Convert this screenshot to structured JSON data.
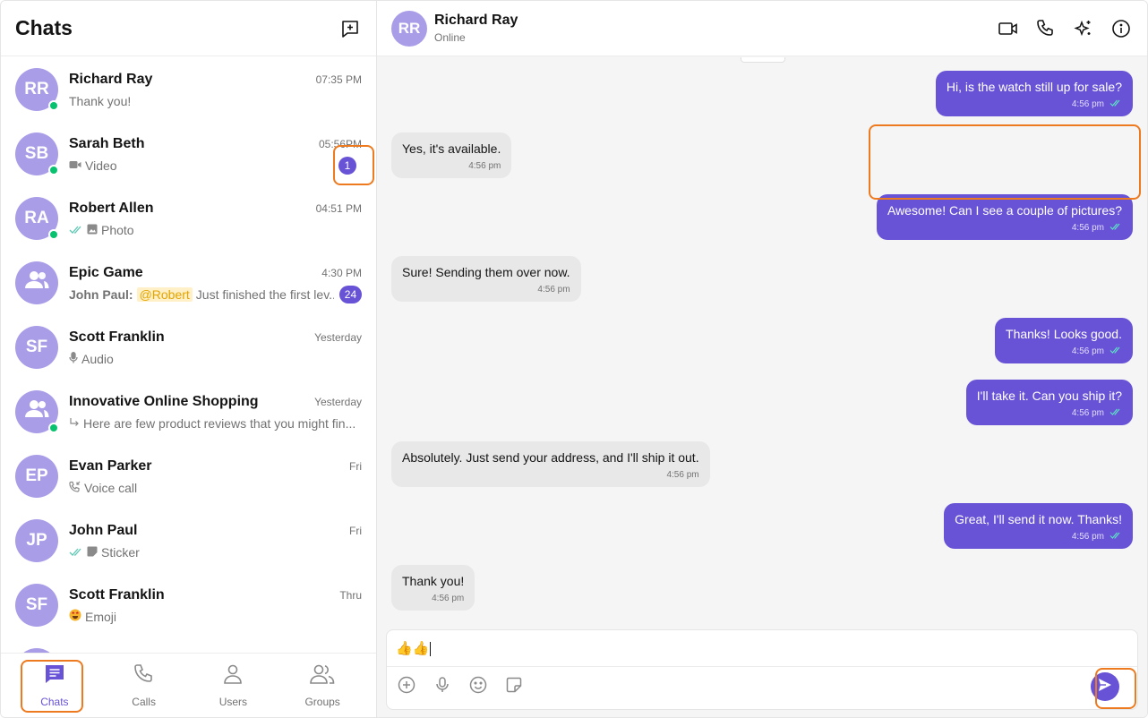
{
  "sidebar": {
    "title": "Chats",
    "new_chat_icon": "new-chat-icon",
    "chats": [
      {
        "initials": "RR",
        "name": "Richard Ray",
        "time": "07:35 PM",
        "preview": "Thank you!",
        "online": true
      },
      {
        "initials": "SB",
        "name": "Sarah Beth",
        "time": "05:56PM",
        "preview": "Video",
        "preview_icon": "video-icon",
        "badge": "1",
        "online": true
      },
      {
        "initials": "RA",
        "name": "Robert Allen",
        "time": "04:51 PM",
        "preview": "Photo",
        "preview_icon": "photo-icon",
        "read": true,
        "online": true
      },
      {
        "initials": "",
        "name": "Epic Game",
        "time": "4:30 PM",
        "sender": "John Paul:",
        "mention": "@Robert",
        "preview": "Just finished the first lev...",
        "badge": "24",
        "group": true
      },
      {
        "initials": "SF",
        "name": "Scott Franklin",
        "time": "Yesterday",
        "preview": "Audio",
        "preview_icon": "mic-icon"
      },
      {
        "initials": "",
        "name": "Innovative Online Shopping",
        "time": "Yesterday",
        "preview": "Here are few product reviews that you might fin...",
        "preview_icon": "reply-icon",
        "group": true,
        "online": true
      },
      {
        "initials": "EP",
        "name": "Evan Parker",
        "time": "Fri",
        "preview": "Voice call",
        "preview_icon": "incoming-call-icon"
      },
      {
        "initials": "JP",
        "name": "John Paul",
        "time": "Fri",
        "preview": "Sticker",
        "preview_icon": "sticker-icon",
        "read": true
      },
      {
        "initials": "SF",
        "name": "Scott Franklin",
        "time": "Thru",
        "preview": "Emoji",
        "preview_icon": "emoji-icon"
      }
    ]
  },
  "tabs": [
    {
      "label": "Chats",
      "icon": "chat-bubble-icon",
      "active": true
    },
    {
      "label": "Calls",
      "icon": "phone-icon"
    },
    {
      "label": "Users",
      "icon": "user-icon"
    },
    {
      "label": "Groups",
      "icon": "group-icon"
    }
  ],
  "header": {
    "initials": "RR",
    "name": "Richard Ray",
    "status": "Online"
  },
  "messages": [
    {
      "dir": "out",
      "text": "Hi, is the watch still up for sale?",
      "time": "4:56 pm"
    },
    {
      "dir": "in",
      "text": "Yes, it's available.",
      "time": "4:56 pm"
    },
    {
      "dir": "out",
      "text": "Awesome! Can I see a couple of pictures?",
      "time": "4:56 pm"
    },
    {
      "dir": "in",
      "text": "Sure! Sending them over now.",
      "time": "4:56 pm"
    },
    {
      "dir": "out",
      "text": "Thanks! Looks good.",
      "time": "4:56 pm"
    },
    {
      "dir": "out",
      "text": "I'll take it. Can you ship it?",
      "time": "4:56 pm"
    },
    {
      "dir": "in",
      "text": "Absolutely. Just send your address, and I'll ship it out.",
      "time": "4:56 pm"
    },
    {
      "dir": "out",
      "text": "Great, I'll send it now. Thanks!",
      "time": "4:56 pm"
    },
    {
      "dir": "in",
      "text": "Thank you!",
      "time": "4:56 pm"
    }
  ],
  "composer": {
    "value": "👍👍"
  },
  "colors": {
    "accent": "#6852d6",
    "avatar": "#a99de8",
    "online": "#09c26f",
    "highlight": "#ee7a1f"
  }
}
